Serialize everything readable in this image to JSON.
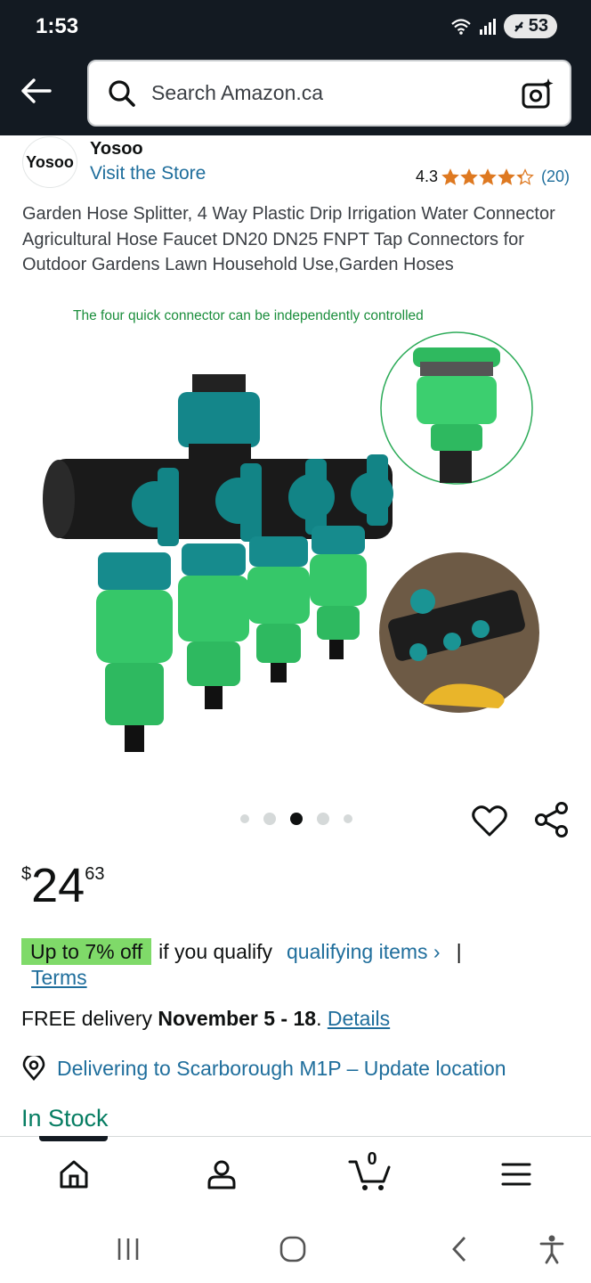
{
  "status_bar": {
    "time": "1:53",
    "battery": "53"
  },
  "header": {
    "search_placeholder": "Search Amazon.ca"
  },
  "brand": {
    "logo_text": "Yosoo",
    "name": "Yosoo",
    "visit_store": "Visit the Store"
  },
  "rating": {
    "value": "4.3",
    "stars": 4.3,
    "count": "(20)"
  },
  "product": {
    "title": "Garden Hose Splitter, 4 Way Plastic Drip Irrigation Water Connector Agricultural Hose Faucet DN20 DN25 FNPT Tap Connectors for Outdoor Gardens Lawn Household Use,Garden Hoses",
    "image_caption": "The four quick connector can be independently controlled",
    "image_count": 5,
    "active_image_index": 2
  },
  "price": {
    "symbol": "$",
    "whole": "24",
    "fraction": "63"
  },
  "promo": {
    "badge": "Up to 7% off",
    "text": "if you qualify",
    "qualifying_link": "qualifying items ›",
    "separator": "|",
    "terms": "Terms"
  },
  "delivery": {
    "prefix": "FREE delivery",
    "dates": "November 5 - 18",
    "suffix": ".",
    "details": "Details"
  },
  "location": {
    "text": "Delivering to Scarborough M1P – Update location"
  },
  "stock": {
    "text": "In Stock"
  },
  "bottom_nav": {
    "cart_count": "0",
    "items": [
      "home-icon",
      "account-icon",
      "cart-icon",
      "menu-icon"
    ]
  },
  "colors": {
    "header_bg": "#131a22",
    "link": "#1f6e9c",
    "promo_badge": "#7fda69",
    "in_stock": "#067d62",
    "star": "#de7921"
  }
}
